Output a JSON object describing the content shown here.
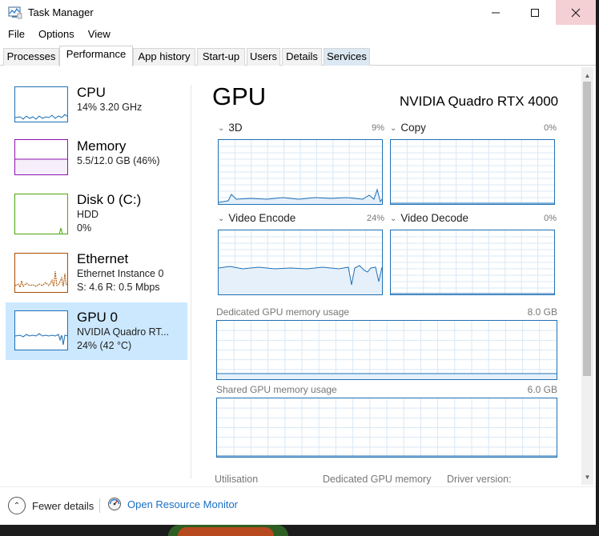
{
  "window": {
    "title": "Task Manager"
  },
  "menu": [
    "File",
    "Options",
    "View"
  ],
  "tabs": [
    "Processes",
    "Performance",
    "App history",
    "Start-up",
    "Users",
    "Details",
    "Services"
  ],
  "active_tab": "Performance",
  "left_items": [
    {
      "title": "CPU",
      "lines": [
        "14%  3.20 GHz"
      ],
      "color": "#1f70b5",
      "icon": "cpu-graph"
    },
    {
      "title": "Memory",
      "lines": [
        "5.5/12.0 GB (46%)"
      ],
      "color": "#8b12ae",
      "icon": "memory-graph"
    },
    {
      "title": "Disk 0 (C:)",
      "lines": [
        "HDD",
        "0%"
      ],
      "color": "#4da60c",
      "icon": "disk-graph"
    },
    {
      "title": "Ethernet",
      "lines": [
        "Ethernet Instance 0",
        "S: 4.6  R: 0.5 Mbps"
      ],
      "color": "#a74f01",
      "icon": "ethernet-graph"
    },
    {
      "title": "GPU 0",
      "lines": [
        "NVIDIA Quadro RT...",
        "24%  (42 °C)"
      ],
      "color": "#1f70b5",
      "icon": "gpu-graph",
      "selected": true
    }
  ],
  "gpu": {
    "title": "GPU",
    "model": "NVIDIA Quadro RTX 4000",
    "engines": [
      {
        "label": "3D",
        "percent": "9%"
      },
      {
        "label": "Copy",
        "percent": "0%"
      },
      {
        "label": "Video Encode",
        "percent": "24%"
      },
      {
        "label": "Video Decode",
        "percent": "0%"
      }
    ],
    "dedicated": {
      "label": "Dedicated GPU memory usage",
      "max": "8.0 GB"
    },
    "shared": {
      "label": "Shared GPU memory usage",
      "max": "6.0 GB"
    },
    "stats": [
      "Utilisation",
      "Dedicated GPU memory",
      "Driver version:"
    ]
  },
  "footer": {
    "fewer_details": "Fewer details",
    "open_resource_monitor": "Open Resource Monitor"
  },
  "colors": {
    "accent": "#1f70b5",
    "selection": "#cce8ff",
    "link": "#1a6fc4",
    "close_hover": "#f4cfd3"
  }
}
